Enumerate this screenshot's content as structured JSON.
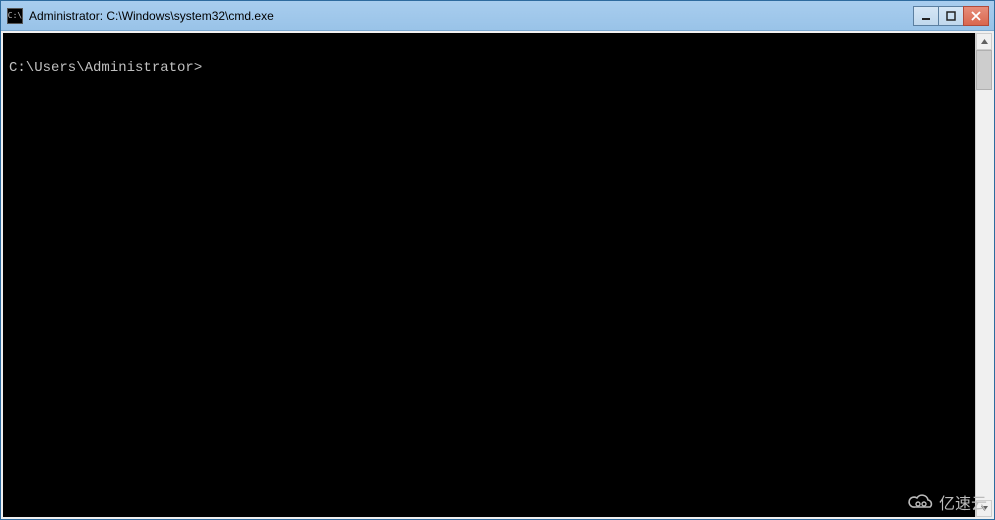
{
  "window": {
    "title": "Administrator: C:\\Windows\\system32\\cmd.exe",
    "icon_label": "C:\\"
  },
  "terminal": {
    "prompt": "C:\\Users\\Administrator>"
  },
  "watermark": {
    "text": "亿速云"
  }
}
